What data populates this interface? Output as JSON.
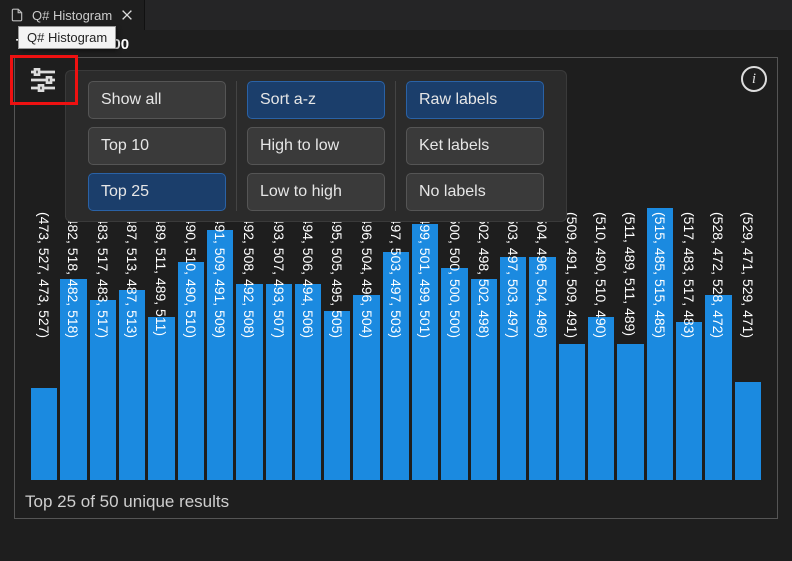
{
  "tab": {
    "title": "Q# Histogram"
  },
  "tooltip": "Q# Histogram",
  "total_shots_label": "Total shots: 100",
  "footer": "Top 25 of 50 unique results",
  "filters": {
    "count_group": [
      {
        "label": "Show all",
        "selected": false
      },
      {
        "label": "Top 10",
        "selected": false
      },
      {
        "label": "Top 25",
        "selected": true
      }
    ],
    "sort_group": [
      {
        "label": "Sort a-z",
        "selected": true
      },
      {
        "label": "High to low",
        "selected": false
      },
      {
        "label": "Low to high",
        "selected": false
      }
    ],
    "label_group": [
      {
        "label": "Raw labels",
        "selected": true
      },
      {
        "label": "Ket labels",
        "selected": false
      },
      {
        "label": "No labels",
        "selected": false
      }
    ]
  },
  "chart_data": {
    "type": "bar",
    "title": "",
    "xlabel": "",
    "ylabel": "",
    "ylim": [
      0,
      100
    ],
    "categories": [
      "(473, 527, 473, 527)",
      "(482, 518, 482, 518)",
      "(483, 517, 483, 517)",
      "(487, 513, 487, 513)",
      "(489, 511, 489, 511)",
      "(490, 510, 490, 510)",
      "(491, 509, 491, 509)",
      "(492, 508, 492, 508)",
      "(493, 507, 493, 507)",
      "(494, 506, 494, 506)",
      "(495, 505, 495, 505)",
      "(496, 504, 496, 504)",
      "(497, 503, 497, 503)",
      "(499, 501, 499, 501)",
      "(500, 500, 500, 500)",
      "(502, 498, 502, 498)",
      "(503, 497, 503, 497)",
      "(504, 496, 504, 496)",
      "(509, 491, 509, 491)",
      "(510, 490, 510, 490)",
      "(511, 489, 511, 489)",
      "(515, 485, 515, 485)",
      "(517, 483, 517, 483)",
      "(528, 472, 528, 472)",
      "(529, 471, 529, 471)"
    ],
    "values": [
      34,
      74,
      66,
      70,
      60,
      80,
      92,
      72,
      72,
      72,
      62,
      68,
      84,
      94,
      78,
      74,
      82,
      82,
      50,
      60,
      50,
      100,
      58,
      68,
      36
    ]
  }
}
